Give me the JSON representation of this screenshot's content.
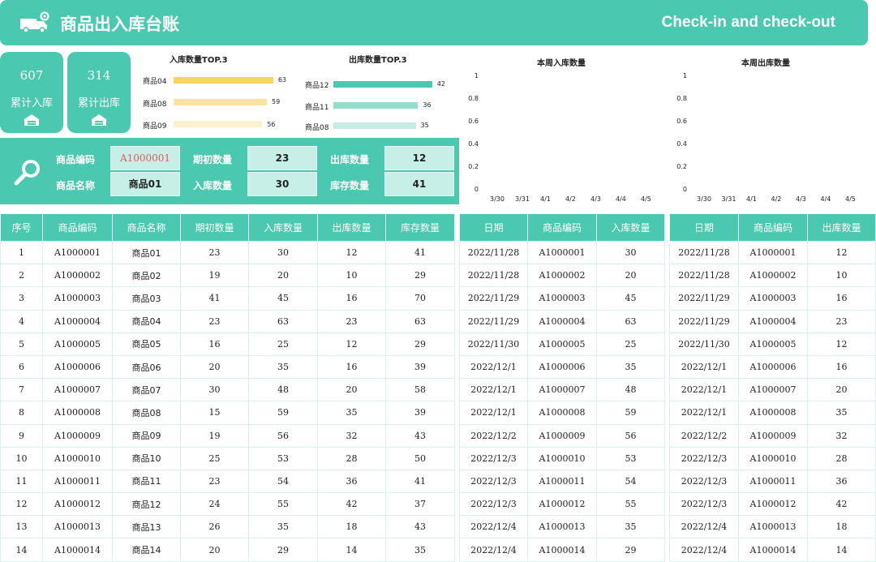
{
  "header": {
    "title": "商品出入库台账",
    "subtitle": "Check-in and check-out"
  },
  "kpis": [
    {
      "value": "607",
      "label": "累计入库"
    },
    {
      "value": "314",
      "label": "累计出库"
    }
  ],
  "colors": {
    "accent": "#4ac9b0",
    "in_bar": "#f9d465",
    "out_bar": "#4ac9b0"
  },
  "chart_data": [
    {
      "type": "bar",
      "title": "入库数量TOP.3",
      "categories": [
        "商品04",
        "商品08",
        "商品09"
      ],
      "values": [
        63,
        59,
        56
      ]
    },
    {
      "type": "bar",
      "title": "出库数量TOP.3",
      "categories": [
        "商品12",
        "商品11",
        "商品08"
      ],
      "values": [
        42,
        36,
        35
      ]
    },
    {
      "type": "line",
      "title": "本周入库数量",
      "categories": [
        "3/30",
        "3/31",
        "4/1",
        "4/2",
        "4/3",
        "4/4",
        "4/5"
      ],
      "yticks": [
        "0",
        "0.2",
        "0.4",
        "0.6",
        "0.8",
        "1"
      ],
      "ylim": [
        0,
        1
      ],
      "series": []
    },
    {
      "type": "line",
      "title": "本周出库数量",
      "categories": [
        "3/30",
        "3/31",
        "4/1",
        "4/2",
        "4/3",
        "4/4",
        "4/5"
      ],
      "yticks": [
        "0",
        "0.2",
        "0.4",
        "0.6",
        "0.8",
        "1"
      ],
      "ylim": [
        0,
        1
      ],
      "series": []
    }
  ],
  "search": {
    "code_label": "商品编码",
    "code_value": "A1000001",
    "name_label": "商品名称",
    "name_value": "商品01",
    "opening_label": "期初数量",
    "opening_value": "23",
    "in_label": "入库数量",
    "in_value": "30",
    "out_label": "出库数量",
    "out_value": "12",
    "stock_label": "库存数量",
    "stock_value": "41"
  },
  "main_table": {
    "headers": [
      "序号",
      "商品编码",
      "商品名称",
      "期初数量",
      "入库数量",
      "出库数量",
      "库存数量"
    ],
    "rows": [
      [
        "1",
        "A1000001",
        "商品01",
        "23",
        "30",
        "12",
        "41"
      ],
      [
        "2",
        "A1000002",
        "商品02",
        "19",
        "20",
        "10",
        "29"
      ],
      [
        "3",
        "A1000003",
        "商品03",
        "41",
        "45",
        "16",
        "70"
      ],
      [
        "4",
        "A1000004",
        "商品04",
        "23",
        "63",
        "23",
        "63"
      ],
      [
        "5",
        "A1000005",
        "商品05",
        "16",
        "25",
        "12",
        "29"
      ],
      [
        "6",
        "A1000006",
        "商品06",
        "20",
        "35",
        "16",
        "39"
      ],
      [
        "7",
        "A1000007",
        "商品07",
        "30",
        "48",
        "20",
        "58"
      ],
      [
        "8",
        "A1000008",
        "商品08",
        "15",
        "59",
        "35",
        "39"
      ],
      [
        "9",
        "A1000009",
        "商品09",
        "19",
        "56",
        "32",
        "43"
      ],
      [
        "10",
        "A1000010",
        "商品10",
        "25",
        "53",
        "28",
        "50"
      ],
      [
        "11",
        "A1000011",
        "商品11",
        "23",
        "54",
        "36",
        "41"
      ],
      [
        "12",
        "A1000012",
        "商品12",
        "24",
        "55",
        "42",
        "37"
      ],
      [
        "13",
        "A1000013",
        "商品13",
        "26",
        "35",
        "18",
        "43"
      ],
      [
        "14",
        "A1000014",
        "商品14",
        "20",
        "29",
        "14",
        "35"
      ]
    ]
  },
  "in_table": {
    "headers": [
      "日期",
      "商品编码",
      "入库数量"
    ],
    "rows": [
      [
        "2022/11/28",
        "A1000001",
        "30"
      ],
      [
        "2022/11/28",
        "A1000002",
        "20"
      ],
      [
        "2022/11/29",
        "A1000003",
        "45"
      ],
      [
        "2022/11/29",
        "A1000004",
        "63"
      ],
      [
        "2022/11/30",
        "A1000005",
        "25"
      ],
      [
        "2022/12/1",
        "A1000006",
        "35"
      ],
      [
        "2022/12/1",
        "A1000007",
        "48"
      ],
      [
        "2022/12/1",
        "A1000008",
        "59"
      ],
      [
        "2022/12/2",
        "A1000009",
        "56"
      ],
      [
        "2022/12/3",
        "A1000010",
        "53"
      ],
      [
        "2022/12/3",
        "A1000011",
        "54"
      ],
      [
        "2022/12/3",
        "A1000012",
        "55"
      ],
      [
        "2022/12/4",
        "A1000013",
        "35"
      ],
      [
        "2022/12/4",
        "A1000014",
        "29"
      ]
    ]
  },
  "out_table": {
    "headers": [
      "日期",
      "商品编码",
      "出库数量"
    ],
    "rows": [
      [
        "2022/11/28",
        "A1000001",
        "12"
      ],
      [
        "2022/11/28",
        "A1000002",
        "10"
      ],
      [
        "2022/11/29",
        "A1000003",
        "16"
      ],
      [
        "2022/11/29",
        "A1000004",
        "23"
      ],
      [
        "2022/11/30",
        "A1000005",
        "12"
      ],
      [
        "2022/12/1",
        "A1000006",
        "16"
      ],
      [
        "2022/12/1",
        "A1000007",
        "20"
      ],
      [
        "2022/12/1",
        "A1000008",
        "35"
      ],
      [
        "2022/12/2",
        "A1000009",
        "32"
      ],
      [
        "2022/12/3",
        "A1000010",
        "28"
      ],
      [
        "2022/12/3",
        "A1000011",
        "36"
      ],
      [
        "2022/12/3",
        "A1000012",
        "42"
      ],
      [
        "2022/12/4",
        "A1000013",
        "18"
      ],
      [
        "2022/12/4",
        "A1000014",
        "14"
      ]
    ]
  }
}
